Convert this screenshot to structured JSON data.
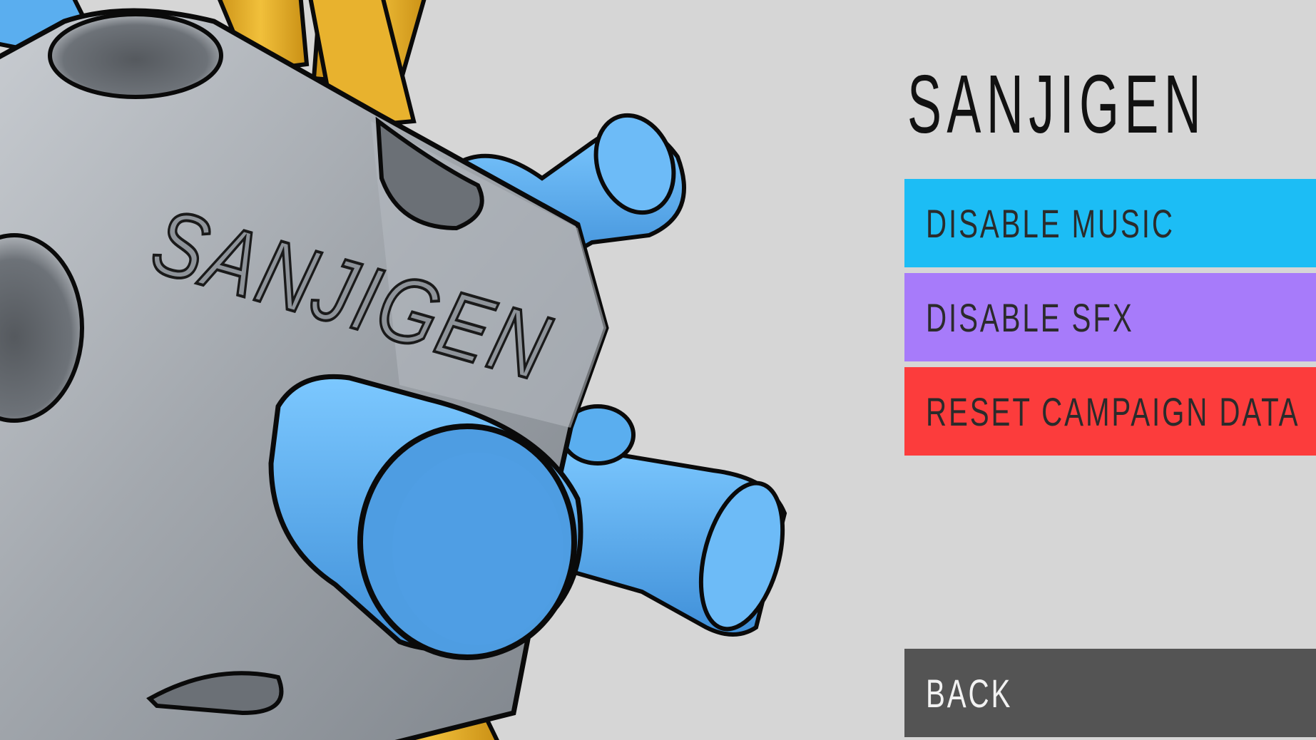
{
  "game": {
    "title": "SANJIGEN",
    "emboss_text": "SANJIGEN"
  },
  "menu": {
    "buttons": [
      {
        "label": "DISABLE MUSIC",
        "color": "#1cbdf5"
      },
      {
        "label": "DISABLE SFX",
        "color": "#a77bfa"
      },
      {
        "label": "RESET CAMPAIGN DATA",
        "color": "#fc3c3c"
      }
    ],
    "back": {
      "label": "BACK",
      "color": "#545454"
    }
  },
  "colors": {
    "background": "#d6d6d6",
    "body_gray": "#9aa0a7",
    "connector_blue": "#5aaeef",
    "rod_yellow": "#e3aa2a",
    "outline": "#0a0a0a"
  }
}
